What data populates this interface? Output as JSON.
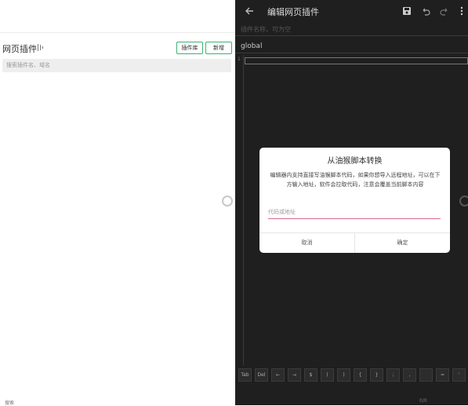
{
  "left_panel": {
    "title": "网页插件",
    "plugin_store_label": "插件库",
    "new_label": "新增",
    "search_placeholder": "搜索插件名、域名"
  },
  "editor": {
    "title": "编辑网页插件",
    "name_placeholder": "插件名称，可为空",
    "scope": "global",
    "line_number": "1",
    "keys": [
      "Tab",
      "Del",
      "←",
      "→",
      "$",
      "(",
      ")",
      "{",
      "}",
      ";",
      ",",
      "",
      "=",
      "'"
    ],
    "search_label": "搜索",
    "match_count": "0/0"
  },
  "dialog": {
    "title": "从油猴脚本转换",
    "message": "编辑器内支持直接写油猴脚本代码，如果你想导入远程地址，可以在下方输入地址，软件会拉取代码，注意会覆盖当前脚本内容",
    "input_placeholder": "代码或地址",
    "cancel_label": "取消",
    "confirm_label": "确定"
  },
  "colors": {
    "accent_green": "#3cb371",
    "input_underline": "#d86a94",
    "editor_bg": "#1f1f1f"
  }
}
